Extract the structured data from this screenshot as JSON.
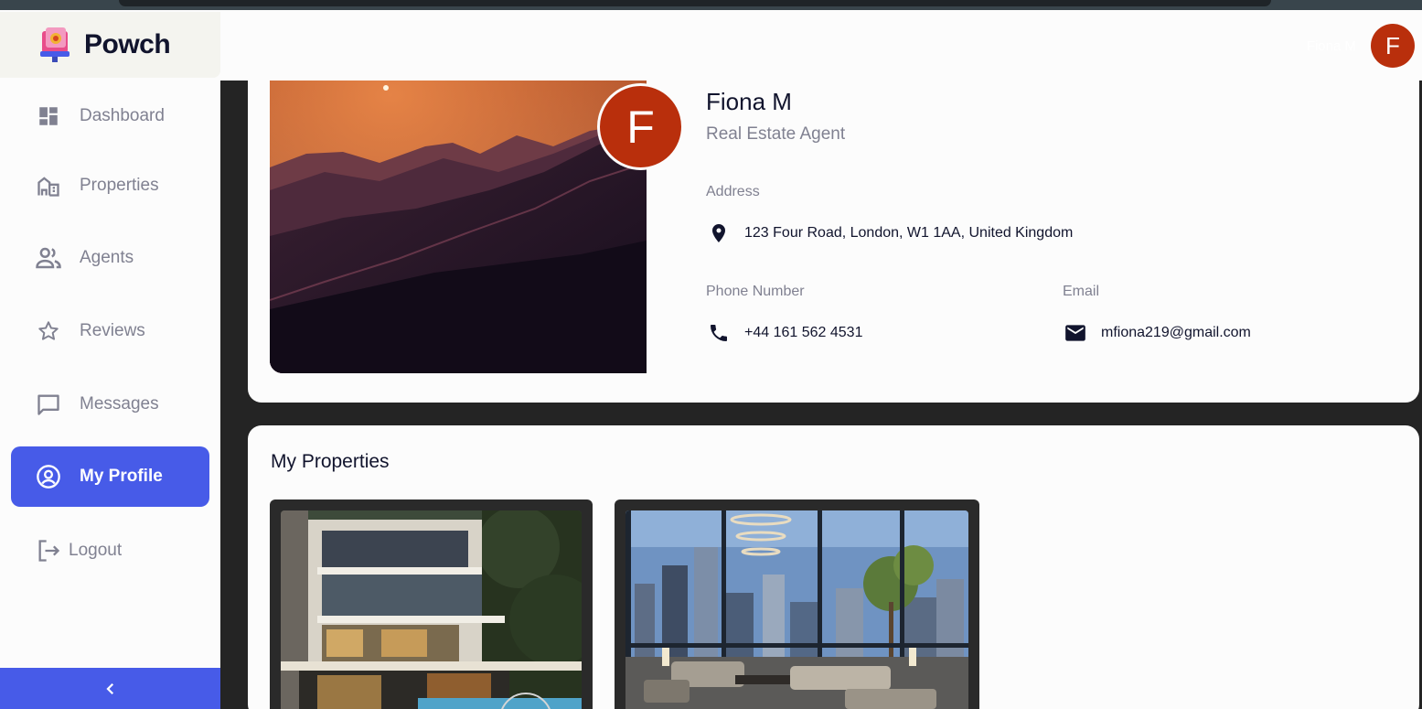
{
  "app": {
    "name": "Powch"
  },
  "header": {
    "user_name": "Fiona M",
    "avatar_initial": "F"
  },
  "sidebar": {
    "items": [
      {
        "label": "Dashboard",
        "icon": "dashboard-icon"
      },
      {
        "label": "Properties",
        "icon": "properties-icon"
      },
      {
        "label": "Agents",
        "icon": "agents-icon"
      },
      {
        "label": "Reviews",
        "icon": "star-icon"
      },
      {
        "label": "Messages",
        "icon": "message-icon"
      },
      {
        "label": "My Profile",
        "icon": "account-circle-icon",
        "active": true
      },
      {
        "label": "Logout",
        "icon": "logout-icon"
      }
    ],
    "collapse_icon": "chevron-left-icon"
  },
  "profile": {
    "avatar_initial": "F",
    "name": "Fiona M",
    "role": "Real Estate Agent",
    "address_label": "Address",
    "address": "123 Four Road, London, W1 1AA, United Kingdom",
    "phone_label": "Phone Number",
    "phone": "+44 161 562 4531",
    "email_label": "Email",
    "email": "mfiona219@gmail.com"
  },
  "my_properties": {
    "title": "My Properties",
    "items": [
      {
        "image": "modern-house-photo"
      },
      {
        "image": "penthouse-interior-photo"
      }
    ]
  },
  "colors": {
    "accent": "#475be8",
    "avatar": "#b92f0c",
    "background": "#242424",
    "card": "#fcfcfc",
    "muted_text": "#808191",
    "primary_text": "#11142d"
  }
}
